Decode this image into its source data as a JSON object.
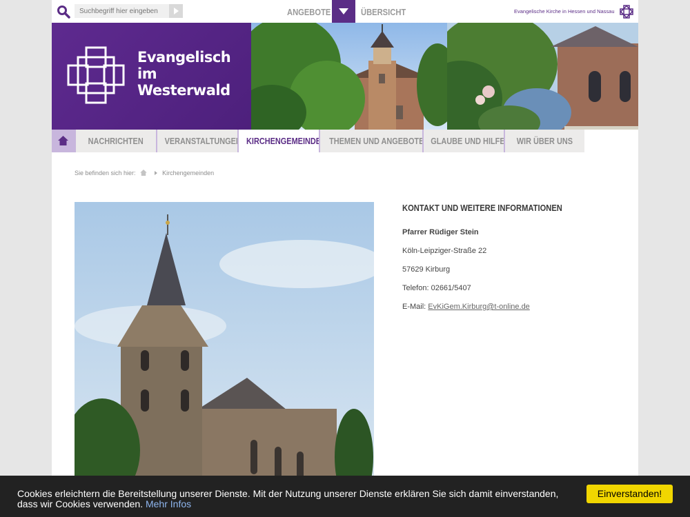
{
  "search": {
    "placeholder": "Suchbegriff hier eingeben"
  },
  "topnav": {
    "angebote": "ANGEBOTE",
    "uebersicht": "ÜBERSICHT"
  },
  "ekhn": {
    "label": "Evangelische Kirche in Hessen und Nassau"
  },
  "logo": {
    "line1": "Evangelisch",
    "line2": "im",
    "line3": "Westerwald"
  },
  "nav": {
    "items": [
      {
        "label": "NACHRICHTEN"
      },
      {
        "label": "VERANSTALTUNGEN"
      },
      {
        "label": "KIRCHENGEMEINDEN"
      },
      {
        "label": "THEMEN UND ANGEBOTE"
      },
      {
        "label": "GLAUBE UND HILFE"
      },
      {
        "label": "WIR ÜBER UNS"
      }
    ],
    "active_index": 2
  },
  "breadcrumb": {
    "prefix": "Sie befinden sich hier:",
    "current": "Kirchengemeinden"
  },
  "contact": {
    "title": "KONTAKT UND WEITERE INFORMATIONEN",
    "name": "Pfarrer Rüdiger Stein",
    "street": "Köln-Leipziger-Straße 22",
    "city": "57629 Kirburg",
    "phone": "Telefon: 02661/5407",
    "email_label": "E-Mail:",
    "email": "EvKiGem.Kirburg@t-online.de"
  },
  "cookie": {
    "text": "Cookies erleichtern die Bereitstellung unserer Dienste. Mit der Nutzung unserer Dienste erklären Sie sich damit einverstanden, dass wir Cookies verwenden.",
    "more": "Mehr Infos",
    "accept": "Einverstanden!"
  },
  "colors": {
    "brand": "#5b2d86",
    "nav_bg": "#ecebea",
    "cookie_bg": "#222222",
    "cookie_btn": "#f1d600"
  }
}
